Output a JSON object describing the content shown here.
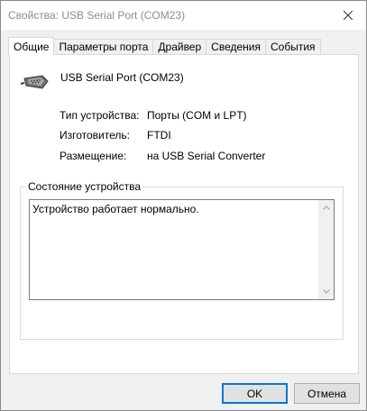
{
  "window": {
    "title": "Свойства: USB Serial Port (COM23)"
  },
  "tabs": [
    {
      "label": "Общие"
    },
    {
      "label": "Параметры порта"
    },
    {
      "label": "Драйвер"
    },
    {
      "label": "Сведения"
    },
    {
      "label": "События"
    }
  ],
  "device": {
    "name": "USB Serial Port (COM23)",
    "icon": "serial-port-connector-icon"
  },
  "properties": [
    {
      "label": "Тип устройства:",
      "value": "Порты (COM и LPT)"
    },
    {
      "label": "Изготовитель:",
      "value": "FTDI"
    },
    {
      "label": "Размещение:",
      "value": "на USB Serial Converter"
    }
  ],
  "status": {
    "legend": "Состояние устройства",
    "text": "Устройство работает нормально."
  },
  "buttons": {
    "ok": "OK",
    "cancel": "Отмена"
  }
}
